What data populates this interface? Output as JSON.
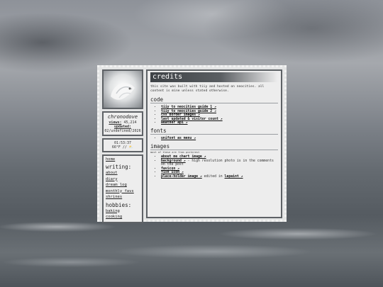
{
  "sidebar": {
    "profile": {
      "name": "chronodove",
      "views_label": "views:",
      "views_value": "45,214",
      "updated_label": "updated:",
      "updated_value": "02/undefined/2026"
    },
    "clock": {
      "time": "01:53:37",
      "weather": "66°F // ⛅"
    },
    "nav": {
      "home": "home",
      "writing_header": "writing:",
      "writing_links": [
        "about",
        "diary",
        "dream log",
        "monthly favs",
        "shrines"
      ],
      "hobbies_header": "hobbies:",
      "hobbies_links": [
        "baking",
        "cooking"
      ]
    }
  },
  "main": {
    "title": "credits",
    "intro": "this site was built with tiiy and hosted on neocities. all content is mine unless stated otherwise.",
    "code": {
      "heading": "code",
      "items": [
        {
          "link": "tiiy to neocities guide 1 ↗"
        },
        {
          "link": "tiiy to neocities guide 2 ↗"
        },
        {
          "link": "css border images ↗"
        },
        {
          "link": "last updated & visitor count ↗"
        },
        {
          "link": "weather api ↗"
        }
      ]
    },
    "fonts": {
      "heading": "fonts",
      "items": [
        {
          "link": "unifont as menu ↗"
        }
      ]
    },
    "images": {
      "heading": "images",
      "subnote": "most of these are from pinterest",
      "items": [
        {
          "link": "about me chart image ↗",
          "after": ""
        },
        {
          "link": "background ↗",
          "after": " - high resolution photo is in the comments on the post"
        },
        {
          "link": "favicon ↗",
          "after": ""
        },
        {
          "link": "fish icon ↗",
          "after": ""
        },
        {
          "link": "place-holder image ↗",
          "after": " edited in ",
          "link2": "lapaint ↗"
        }
      ]
    }
  }
}
